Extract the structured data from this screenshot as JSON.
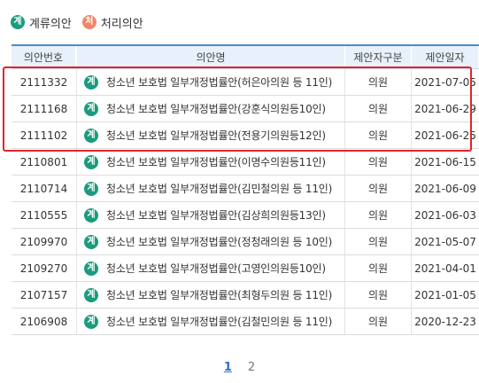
{
  "legend": [
    {
      "icon": "계",
      "label": "계류의안",
      "color": "#1a9b7e"
    },
    {
      "icon": "처",
      "label": "처리의안",
      "color": "#f0856a"
    }
  ],
  "table": {
    "headers": [
      "의안번호",
      "의안명",
      "제안자구분",
      "제안일자"
    ],
    "rows": [
      {
        "no": "2111332",
        "status": "계",
        "title": "청소년 보호법 일부개정법률안(허은아의원 등 11인)",
        "proposer": "의원",
        "date": "2021-07-05"
      },
      {
        "no": "2111168",
        "status": "계",
        "title": "청소년 보호법 일부개정법률안(강훈식의원등10인)",
        "proposer": "의원",
        "date": "2021-06-29"
      },
      {
        "no": "2111102",
        "status": "계",
        "title": "청소년 보호법 일부개정법률안(전용기의원등12인)",
        "proposer": "의원",
        "date": "2021-06-25"
      },
      {
        "no": "2110801",
        "status": "계",
        "title": "청소년 보호법 일부개정법률안(이명수의원등11인)",
        "proposer": "의원",
        "date": "2021-06-15"
      },
      {
        "no": "2110714",
        "status": "계",
        "title": "청소년 보호법 일부개정법률안(김민철의원 등 11인)",
        "proposer": "의원",
        "date": "2021-06-09"
      },
      {
        "no": "2110555",
        "status": "계",
        "title": "청소년 보호법 일부개정법률안(김상희의원등13인)",
        "proposer": "의원",
        "date": "2021-06-03"
      },
      {
        "no": "2109970",
        "status": "계",
        "title": "청소년 보호법 일부개정법률안(정청래의원 등 10인)",
        "proposer": "의원",
        "date": "2021-05-07"
      },
      {
        "no": "2109270",
        "status": "계",
        "title": "청소년 보호법 일부개정법률안(고영인의원등10인)",
        "proposer": "의원",
        "date": "2021-04-01"
      },
      {
        "no": "2107157",
        "status": "계",
        "title": "청소년 보호법 일부개정법률안(최형두의원 등 11인)",
        "proposer": "의원",
        "date": "2021-01-05"
      },
      {
        "no": "2106908",
        "status": "계",
        "title": "청소년 보호법 일부개정법률안(김철민의원 등 11인)",
        "proposer": "의원",
        "date": "2020-12-23"
      }
    ]
  },
  "pagination": {
    "pages": [
      "1",
      "2"
    ],
    "current": "1"
  },
  "colors": {
    "accent": "#2f6fc9",
    "highlight": "#e1252b",
    "pending": "#1a9b7e",
    "processed": "#f0856a"
  }
}
